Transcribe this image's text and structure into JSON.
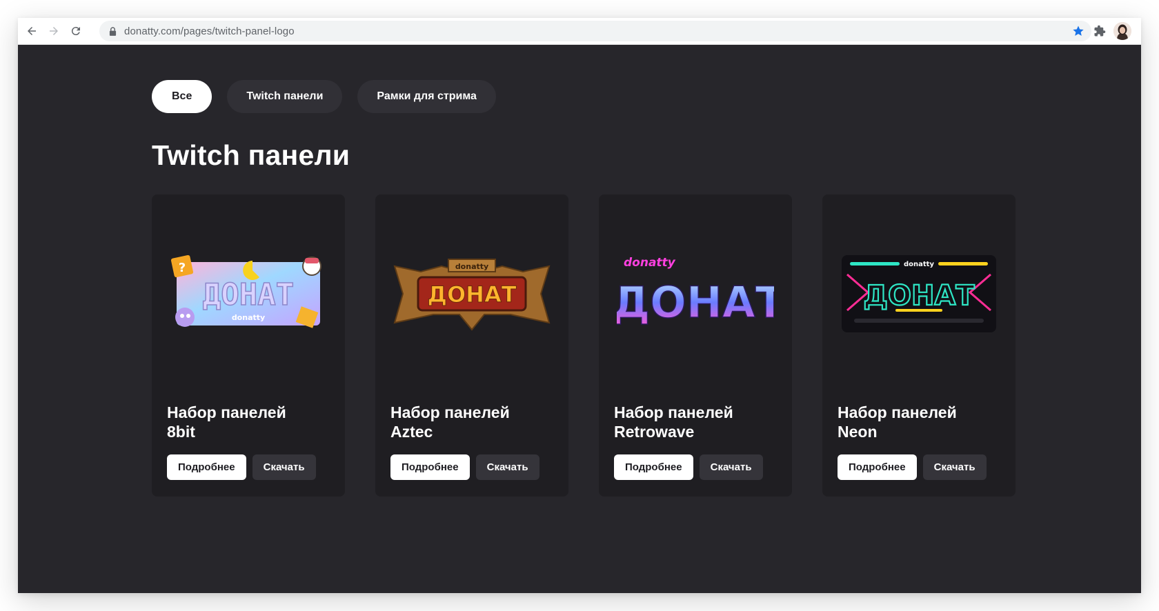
{
  "browser": {
    "url": "donatty.com/pages/twitch-panel-logo"
  },
  "filters": [
    {
      "label": "Все",
      "active": true
    },
    {
      "label": "Twitch панели",
      "active": false
    },
    {
      "label": "Рамки для стрима",
      "active": false
    }
  ],
  "section_title": "Twitch панели",
  "cards": [
    {
      "title_line1": "Набор панелей",
      "title_line2": "8bit",
      "image_text": "ДОНАТ",
      "brand": "donatty",
      "more_label": "Подробнее",
      "download_label": "Скачать"
    },
    {
      "title_line1": "Набор панелей",
      "title_line2": "Aztec",
      "image_text": "ДОНАТ",
      "brand": "donatty",
      "more_label": "Подробнее",
      "download_label": "Скачать"
    },
    {
      "title_line1": "Набор панелей",
      "title_line2": "Retrowave",
      "image_text": "ДОНАТ",
      "brand": "donatty",
      "more_label": "Подробнее",
      "download_label": "Скачать"
    },
    {
      "title_line1": "Набор панелей",
      "title_line2": "Neon",
      "image_text": "ДОНАТ",
      "brand": "donatty",
      "more_label": "Подробнее",
      "download_label": "Скачать"
    }
  ],
  "colors": {
    "page_bg": "#27262b",
    "card_bg": "#1f1e22",
    "bookmark_star": "#1a73e8"
  }
}
